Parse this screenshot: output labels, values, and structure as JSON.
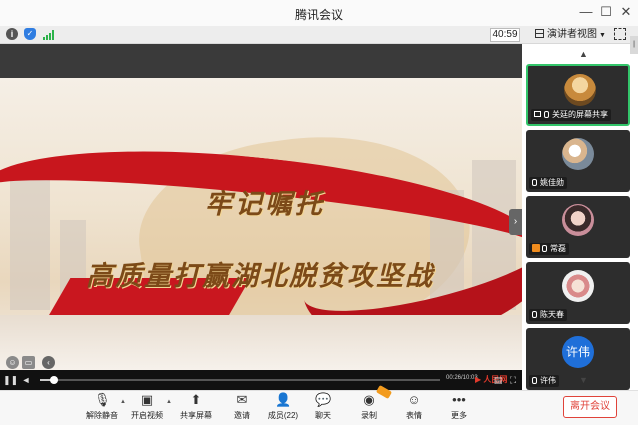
{
  "window": {
    "title": "腾讯会议",
    "controls": {
      "minimize": "—",
      "maximize": "☐",
      "close": "✕"
    }
  },
  "toolbar": {
    "timer": "40:59",
    "view_label": "演讲者视图",
    "signal_color": "#2cb34a"
  },
  "shared_screen": {
    "title_line1": "牢记嘱托",
    "title_line2": "高质量打赢湖北脱贫攻坚战",
    "play_time": "00:26/10:03",
    "ribbon_color": "#c8161d",
    "text_color": "#7c4a18"
  },
  "participants": [
    {
      "name": "关廷的屏幕共享",
      "avatar": "photo",
      "active": true,
      "sharing": true
    },
    {
      "name": "姚佳勋",
      "avatar": "photo"
    },
    {
      "name": "常磊",
      "avatar": "photo",
      "host_badge": true
    },
    {
      "name": "陈天春",
      "avatar": "photo"
    },
    {
      "name": "许伟",
      "avatar": "text",
      "avatar_text": "许伟",
      "avatar_color": "#1f6fd9"
    }
  ],
  "bottom_bar": {
    "items": [
      {
        "id": "unmute",
        "icon": "mic-muted-icon",
        "label": "解除静音"
      },
      {
        "id": "video",
        "icon": "video-off-icon",
        "label": "开启视频"
      },
      {
        "id": "share",
        "icon": "share-screen-icon",
        "label": "共享屏幕"
      },
      {
        "id": "invite",
        "icon": "invite-icon",
        "label": "邀请"
      },
      {
        "id": "members",
        "icon": "members-icon",
        "label": "成员(22)"
      },
      {
        "id": "chat",
        "icon": "chat-icon",
        "label": "聊天"
      },
      {
        "id": "record",
        "icon": "record-icon",
        "label": "录制"
      },
      {
        "id": "emoji",
        "icon": "emoji-icon",
        "label": "表情"
      },
      {
        "id": "more",
        "icon": "more-icon",
        "label": "更多"
      }
    ],
    "leave_label": "离开会议",
    "leave_color": "#e0433a"
  }
}
